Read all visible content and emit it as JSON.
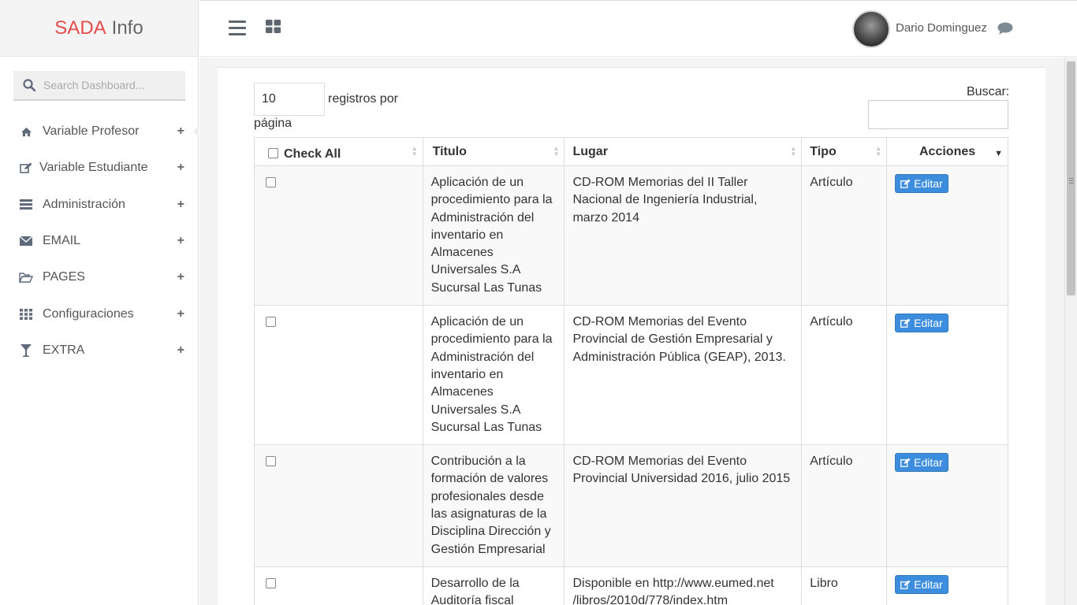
{
  "brand": {
    "part1": "SADA",
    "part2": "Info",
    "accent": "#e74c4c"
  },
  "sidebar": {
    "search_placeholder": "Search Dashboard...",
    "items": [
      {
        "label": "Variable Profesor",
        "icon": "home-icon"
      },
      {
        "label": "Variable Estudiante",
        "icon": "edit-icon"
      },
      {
        "label": "Administración",
        "icon": "list-icon"
      },
      {
        "label": "EMAIL",
        "icon": "envelope-icon"
      },
      {
        "label": "PAGES",
        "icon": "folder-open-icon"
      },
      {
        "label": "Configuraciones",
        "icon": "th-grid-icon"
      },
      {
        "label": "EXTRA",
        "icon": "glass-icon"
      }
    ],
    "expand_symbol": "+"
  },
  "topbar": {
    "username": "Dario Dominguez"
  },
  "table_controls": {
    "length_value": "10",
    "length_label_1": "registros por",
    "length_label_2": "página",
    "search_label": "Buscar:"
  },
  "table": {
    "columns": [
      "Check All",
      "Titulo",
      "Lugar",
      "Tipo",
      "Acciones"
    ],
    "edit_label": "Editar",
    "rows": [
      {
        "titulo": "Aplicación de un procedimiento para la Administración del inventario en Almacenes Universales S.A Sucursal Las Tunas",
        "lugar": "CD-ROM Memorias del II Taller Nacional de Ingeniería Industrial, marzo 2014",
        "tipo": "Artículo"
      },
      {
        "titulo": "Aplicación de un procedimiento para la Administración del inventario en Almacenes Universales S.A Sucursal Las Tunas",
        "lugar": "CD-ROM Memorias del Evento Provincial de Gestión Empresarial y Administración Pública (GEAP), 2013.",
        "tipo": "Artículo"
      },
      {
        "titulo": "Contribución a la formación de valores profesionales desde las asignaturas de la Disciplina Dirección y Gestión Empresarial",
        "lugar": "CD-ROM Memorias del Evento Provincial Universidad 2016, julio 2015",
        "tipo": "Artículo"
      },
      {
        "titulo": "Desarrollo de la Auditoría fiscal",
        "lugar": "Disponible en http://www.eumed.net /libros/2010d/778/index.htm",
        "tipo": "Libro"
      }
    ]
  },
  "colors": {
    "button_blue": "#3c8dde",
    "sidebar_icon": "#5f6b7a"
  }
}
